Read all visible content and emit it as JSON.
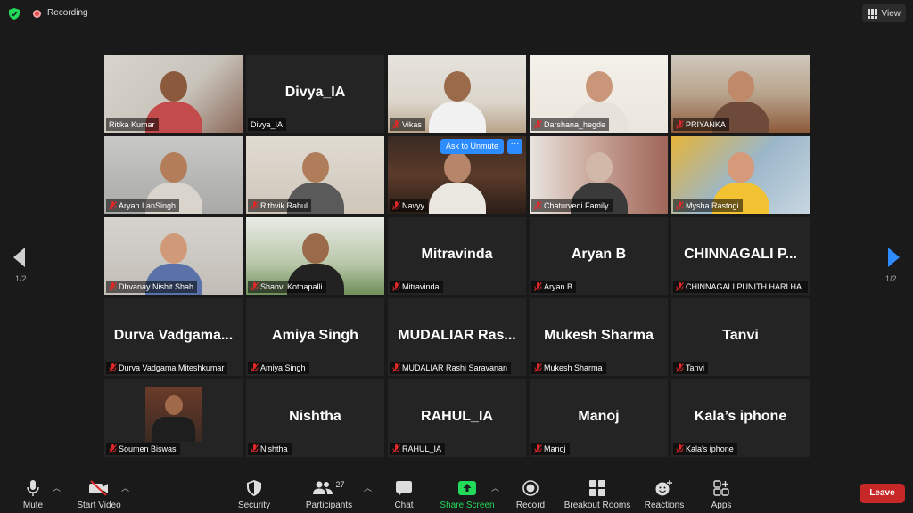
{
  "top": {
    "recording_label": "Recording",
    "view_label": "View"
  },
  "pager": {
    "left": "1/2",
    "right": "1/2"
  },
  "tiles": [
    {
      "label": "Ritika Kumar",
      "big": ""
    },
    {
      "label": "Divya_IA",
      "big": "Divya_IA"
    },
    {
      "label": "Vikas",
      "big": ""
    },
    {
      "label": "Darshana_hegde",
      "big": ""
    },
    {
      "label": "PRIYANKA",
      "big": ""
    },
    {
      "label": "Aryan LanSingh",
      "big": ""
    },
    {
      "label": "Rithvik Rahul",
      "big": ""
    },
    {
      "label": "Navyy",
      "big": ""
    },
    {
      "label": "Chaturvedi Family",
      "big": ""
    },
    {
      "label": "Mysha Rastogi",
      "big": ""
    },
    {
      "label": "Dhvanay Nishit Shah",
      "big": ""
    },
    {
      "label": "Shanvi Kothapalli",
      "big": ""
    },
    {
      "label": "Mitravinda",
      "big": "Mitravinda"
    },
    {
      "label": "Aryan B",
      "big": "Aryan B"
    },
    {
      "label": "CHINNAGALI PUNITH HARI HA...",
      "big": "CHINNAGALI  P..."
    },
    {
      "label": "Durva Vadgama Miteshkumar",
      "big": "Durva  Vadgama..."
    },
    {
      "label": "Amiya Singh",
      "big": "Amiya Singh"
    },
    {
      "label": "MUDALIAR Rashi Saravanan",
      "big": "MUDALIAR  Ras..."
    },
    {
      "label": "Mukesh Sharma",
      "big": "Mukesh Sharma"
    },
    {
      "label": "Tanvi",
      "big": "Tanvi"
    },
    {
      "label": "Soumen Biswas",
      "big": ""
    },
    {
      "label": "Nishtha",
      "big": "Nishtha"
    },
    {
      "label": "RAHUL_IA",
      "big": "RAHUL_IA"
    },
    {
      "label": "Manoj",
      "big": "Manoj"
    },
    {
      "label": "Kala's iphone",
      "big": "Kala’s iphone"
    }
  ],
  "navyy_overlay": {
    "unmute_label": "Ask to Unmute",
    "more_label": "···"
  },
  "toolbar": {
    "mute": "Mute",
    "start_video": "Start Video",
    "security": "Security",
    "participants": "Participants",
    "participants_count": "27",
    "chat": "Chat",
    "share_screen": "Share Screen",
    "record": "Record",
    "breakout_rooms": "Breakout Rooms",
    "reactions": "Reactions",
    "apps": "Apps",
    "leave": "Leave"
  },
  "colors": {
    "active_speaker": "#c7e26b",
    "accent_blue": "#2d8cff",
    "share_green": "#23d959",
    "leave_red": "#c62828",
    "muted_red": "#e02828"
  }
}
